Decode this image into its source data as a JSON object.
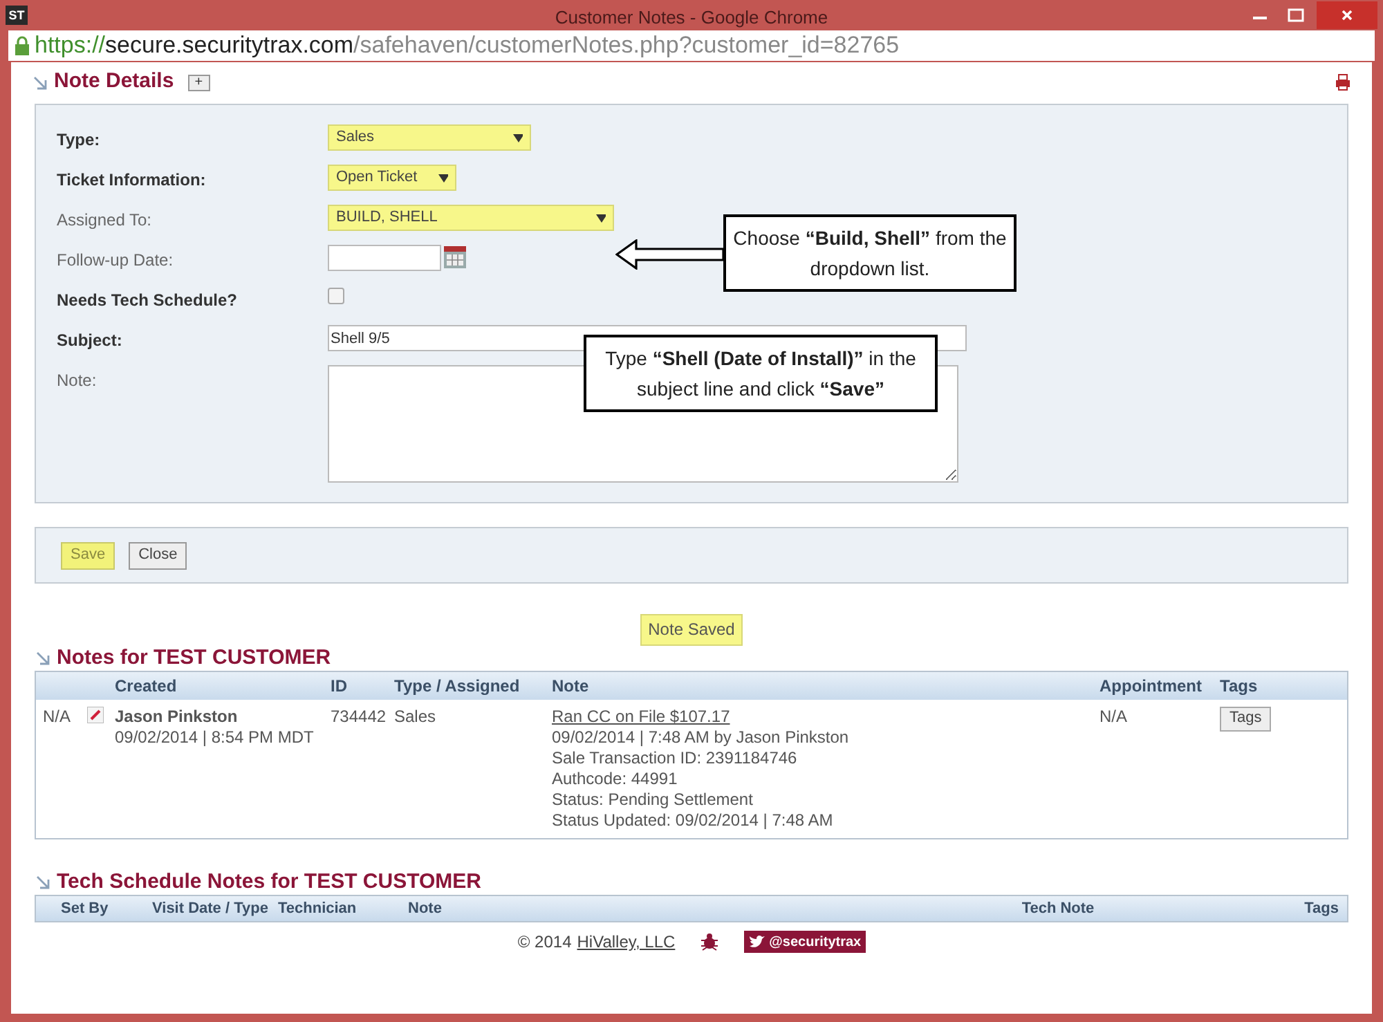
{
  "window": {
    "logo": "ST",
    "title": "Customer Notes - Google Chrome"
  },
  "address_bar": {
    "secure": true,
    "scheme": "https://",
    "host": "secure.securitytrax.com",
    "path": "/safehaven/customerNotes.php?customer_id=82765"
  },
  "note_details": {
    "title": "Note Details",
    "expand_button": "+",
    "fields": [
      {
        "kind": "select",
        "label": "Type:",
        "label_bold": true,
        "value": "Sales",
        "highlighted": true
      },
      {
        "kind": "select",
        "label": "Ticket Information:",
        "label_bold": true,
        "value": "Open Ticket",
        "highlighted": true
      },
      {
        "kind": "select",
        "label": "Assigned To:",
        "label_bold": false,
        "value": "BUILD, SHELL",
        "highlighted": true
      },
      {
        "kind": "date",
        "label": "Follow-up Date:",
        "label_bold": false
      },
      {
        "kind": "checkbox",
        "label": "Needs Tech Schedule?",
        "label_bold": true,
        "checked": false
      },
      {
        "kind": "text",
        "label": "Subject:",
        "label_bold": true,
        "value": "Shell 9/5"
      },
      {
        "kind": "textarea",
        "label": "Note:",
        "label_bold": false
      }
    ]
  },
  "callouts": [
    {
      "text": "Choose **“Build, Shell”** from the dropdown list.",
      "arrow": true
    },
    {
      "text": "Type **“Shell (Date of Install)”** in the subject line and click **“Save”**",
      "arrow": false
    }
  ],
  "buttons": [
    {
      "label": "Save",
      "highlighted": true
    },
    {
      "label": "Close",
      "highlighted": false
    }
  ],
  "status_message": "Note Saved",
  "notes": {
    "title": "Notes for TEST CUSTOMER",
    "columns": [
      "",
      "",
      "Created",
      "ID",
      "Type / Assigned",
      "Note",
      "Appointment",
      "Tags"
    ],
    "rows": [
      {
        "status": "N/A",
        "created_by": "Jason Pinkston",
        "created_at": "09/02/2014 | 8:54 PM MDT",
        "id": "734442",
        "type": "Sales",
        "note_link": "Ran CC on File $107.17",
        "note_lines": [
          "09/02/2014 | 7:48 AM by Jason Pinkston",
          "Sale Transaction ID: 2391184746",
          "Authcode: 44991",
          "Status: Pending Settlement",
          "Status Updated: 09/02/2014 | 7:48 AM"
        ],
        "appointment": "N/A",
        "tags_button": "Tags"
      }
    ]
  },
  "tech_schedule": {
    "title": "Tech Schedule Notes for TEST CUSTOMER",
    "columns": [
      "Set By",
      "Visit Date / Type",
      "Technician",
      "Note",
      "Tech Note",
      "Tags"
    ]
  },
  "footer": {
    "copyright": "© 2014",
    "company_link": "HiValley, LLC",
    "twitter": "@securitytrax"
  }
}
